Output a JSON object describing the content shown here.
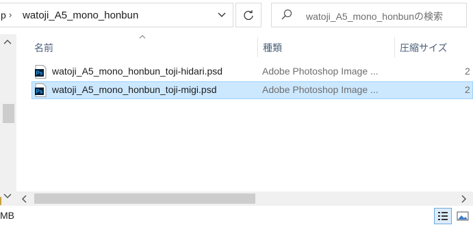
{
  "address": {
    "prev_crumb": "p",
    "current_folder": "watoji_A5_mono_honbun",
    "search_placeholder": "watoji_A5_mono_honbunの検索"
  },
  "columns": {
    "name": "名前",
    "type": "種類",
    "size": "圧縮サイズ"
  },
  "files": [
    {
      "name": "watoji_A5_mono_honbun_toji-hidari.psd",
      "type": "Adobe Photoshop Image ...",
      "size": "2",
      "selected": false,
      "icon": "photoshop-file-icon"
    },
    {
      "name": "watoji_A5_mono_honbun_toji-migi.psd",
      "type": "Adobe Photoshop Image ...",
      "size": "2",
      "selected": true,
      "icon": "photoshop-file-icon"
    }
  ],
  "status": {
    "size_text": "MB"
  },
  "icons": [
    "chevron-down-icon",
    "refresh-icon",
    "search-icon",
    "scroll-up-icon",
    "scroll-down-icon",
    "scroll-left-icon",
    "scroll-right-icon",
    "details-view-icon",
    "large-icons-view-icon",
    "photoshop-file-icon"
  ],
  "colors": {
    "selection_bg": "#cce8ff",
    "selection_border": "#99d1ff",
    "header_text": "#4c607a",
    "ps_icon": "#001d34"
  }
}
